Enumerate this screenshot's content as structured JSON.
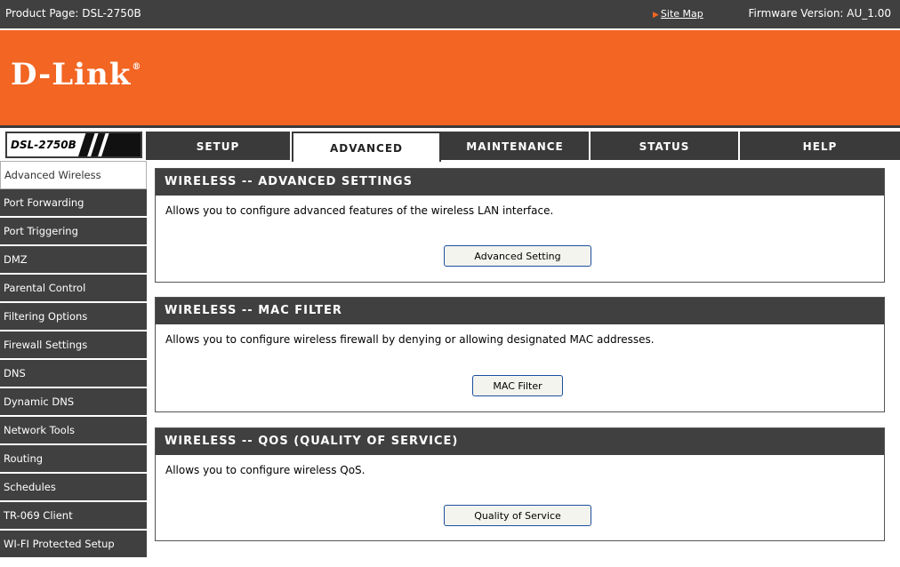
{
  "header": {
    "product_page": "Product Page: DSL-2750B",
    "site_map": "Site Map",
    "firmware": "Firmware Version: AU_1.00"
  },
  "brand": {
    "logo": "D-Link",
    "model": "DSL-2750B"
  },
  "colors": {
    "brand_orange": "#f26522",
    "dark_gray": "#404040"
  },
  "tabs": [
    {
      "label": "SETUP",
      "active": false
    },
    {
      "label": "ADVANCED",
      "active": true
    },
    {
      "label": "MAINTENANCE",
      "active": false
    },
    {
      "label": "STATUS",
      "active": false
    },
    {
      "label": "HELP",
      "active": false
    }
  ],
  "sidebar": {
    "items": [
      {
        "label": "Advanced Wireless",
        "active": true
      },
      {
        "label": "Port Forwarding"
      },
      {
        "label": "Port Triggering"
      },
      {
        "label": "DMZ"
      },
      {
        "label": "Parental Control"
      },
      {
        "label": "Filtering Options"
      },
      {
        "label": "Firewall Settings"
      },
      {
        "label": "DNS"
      },
      {
        "label": "Dynamic DNS"
      },
      {
        "label": "Network Tools"
      },
      {
        "label": "Routing"
      },
      {
        "label": "Schedules"
      },
      {
        "label": "TR-069 Client"
      },
      {
        "label": "WI-FI Protected Setup"
      }
    ]
  },
  "sections": [
    {
      "title": "WIRELESS -- ADVANCED SETTINGS",
      "description": "Allows you to configure advanced features of the wireless LAN interface.",
      "button": "Advanced Setting"
    },
    {
      "title": "WIRELESS -- MAC FILTER",
      "description": "Allows you to configure wireless firewall by denying or allowing designated MAC addresses.",
      "button": "MAC Filter"
    },
    {
      "title": "WIRELESS -- QOS (QUALITY OF SERVICE)",
      "description": "Allows you to configure wireless QoS.",
      "button": "Quality of Service"
    }
  ]
}
